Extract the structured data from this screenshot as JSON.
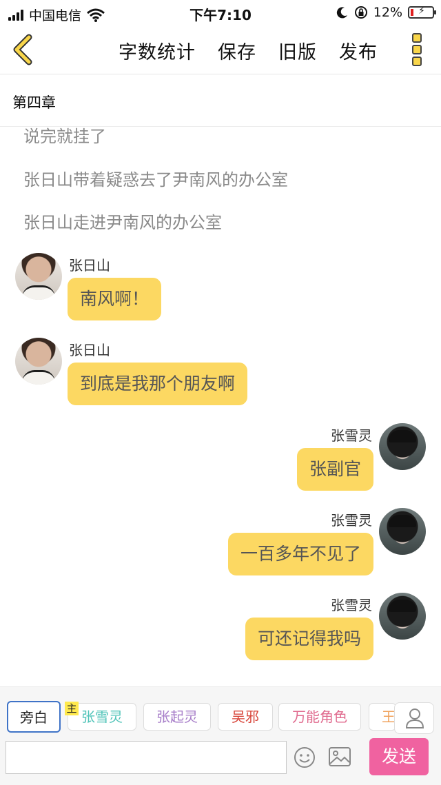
{
  "status_bar": {
    "carrier": "中国电信",
    "time": "下午7:10",
    "battery_percent": "12%",
    "icons": [
      "signal-icon",
      "wifi-icon",
      "moon-icon",
      "orientation-lock-icon",
      "battery-icon"
    ]
  },
  "nav": {
    "back_icon": "chevron-left-icon",
    "actions": [
      "字数统计",
      "保存",
      "旧版",
      "发布"
    ],
    "more_icon": "more-vertical-icon",
    "accent": "#f9d64a"
  },
  "chapter": {
    "title": "第四章"
  },
  "chat": {
    "narration": [
      "说完就挂了",
      "张日山带着疑惑去了尹南风的办公室",
      "张日山走进尹南风的办公室"
    ],
    "messages": [
      {
        "sender": "张日山",
        "side": "left",
        "text": "南风啊！"
      },
      {
        "sender": "张日山",
        "side": "left",
        "text": "到底是我那个朋友啊"
      },
      {
        "sender": "张雪灵",
        "side": "right",
        "text": "张副官"
      },
      {
        "sender": "张雪灵",
        "side": "right",
        "text": "一百多年不见了"
      },
      {
        "sender": "张雪灵",
        "side": "right",
        "text": "可还记得我吗"
      }
    ],
    "bubble_color": "#fcd862"
  },
  "bottom": {
    "roles": [
      "旁白",
      "张雪灵",
      "张起灵",
      "吴邪",
      "万能角色",
      "王"
    ],
    "main_tag": "主",
    "input": {
      "value": "",
      "placeholder": ""
    },
    "send_label": "发送",
    "send_color": "#f062a0"
  }
}
